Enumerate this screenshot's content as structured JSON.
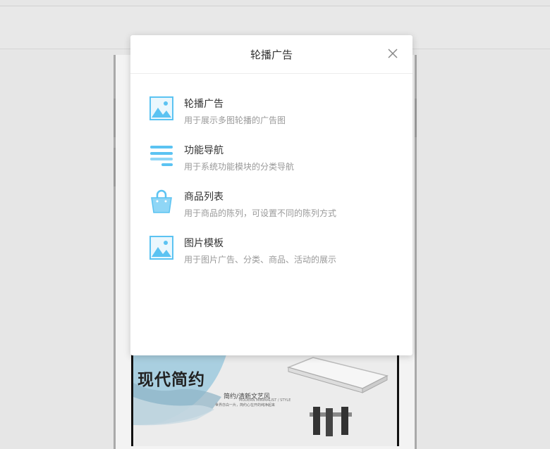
{
  "modal": {
    "title": "轮播广告",
    "items": [
      {
        "name": "轮播广告",
        "desc": "用于展示多图轮播的广告图",
        "icon": "image-icon"
      },
      {
        "name": "功能导航",
        "desc": "用于系统功能模块的分类导航",
        "icon": "menu-lines-icon"
      },
      {
        "name": "商品列表",
        "desc": "用于商品的陈列，可设置不同的陈列方式",
        "icon": "shopping-bag-icon"
      },
      {
        "name": "图片模板",
        "desc": "用于图片广告、分类、商品、活动的展示",
        "icon": "image-icon"
      }
    ]
  },
  "banner": {
    "title": "现代简约",
    "subtitle": "简约/清新文艺风",
    "tagline": "MODERN MINIMALIST / STYLE",
    "small_text": "世界亦白一片，简约心在开的纯净起来"
  },
  "colors": {
    "icon_blue": "#5bc3f2",
    "icon_light": "#bfe7fb"
  }
}
